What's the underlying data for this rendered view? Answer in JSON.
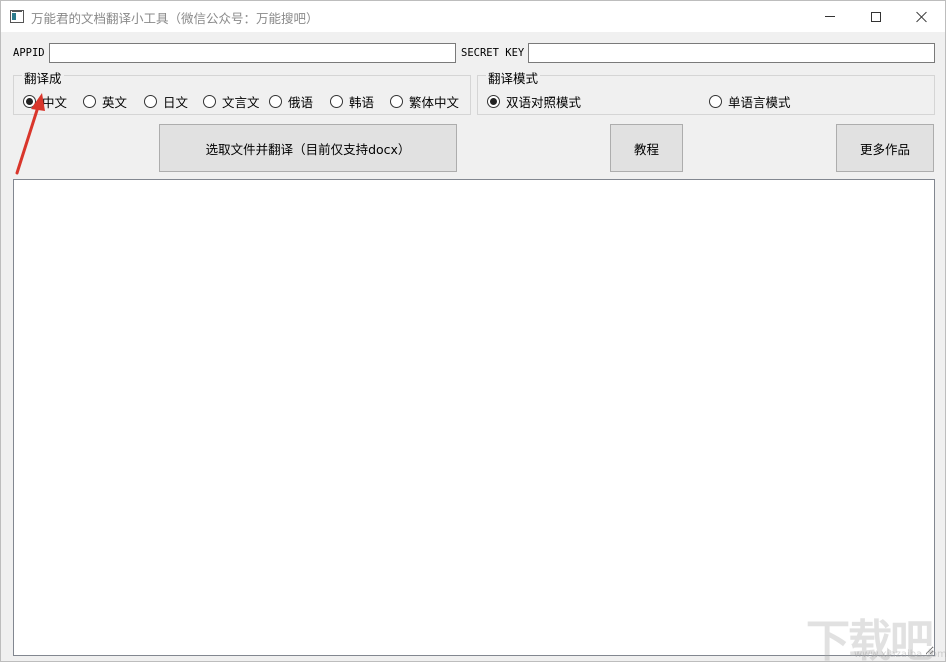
{
  "window": {
    "title": "万能君的文档翻译小工具（微信公众号：万能搜吧）",
    "controls": {
      "minimize": "minimize-icon",
      "maximize": "maximize-icon",
      "close": "close-icon"
    }
  },
  "credentials": {
    "appid_label": "APPID",
    "appid_value": "",
    "secret_label": "SECRET KEY",
    "secret_value": ""
  },
  "target_language": {
    "title": "翻译成",
    "options": [
      {
        "label": "中文",
        "selected": true
      },
      {
        "label": "英文",
        "selected": false
      },
      {
        "label": "日文",
        "selected": false
      },
      {
        "label": "文言文",
        "selected": false
      },
      {
        "label": "俄语",
        "selected": false
      },
      {
        "label": "韩语",
        "selected": false
      },
      {
        "label": "繁体中文",
        "selected": false
      }
    ]
  },
  "translation_mode": {
    "title": "翻译模式",
    "options": [
      {
        "label": "双语对照模式",
        "selected": true
      },
      {
        "label": "单语言模式",
        "selected": false
      }
    ]
  },
  "buttons": {
    "translate": "选取文件并翻译（目前仅支持docx）",
    "tutorial": "教程",
    "more": "更多作品"
  },
  "output": {
    "text": ""
  },
  "watermark": {
    "main": "下载吧",
    "sub": "www.xiazaiba.com"
  },
  "colors": {
    "annotation_arrow": "#d9362b"
  }
}
